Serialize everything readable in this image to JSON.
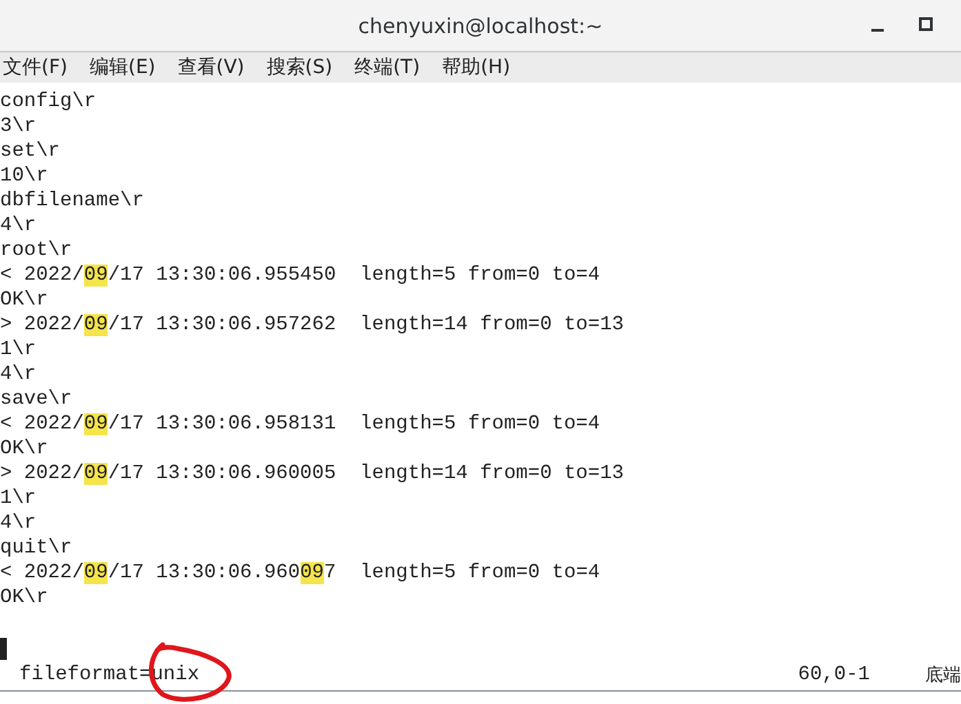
{
  "window": {
    "title": "chenyuxin@localhost:~"
  },
  "menu": [
    "文件(F)",
    "编辑(E)",
    "查看(V)",
    "搜索(S)",
    "终端(T)",
    "帮助(H)"
  ],
  "terminal": {
    "lines": [
      [
        {
          "text": "config\\r",
          "match": false
        }
      ],
      [
        {
          "text": "3\\r",
          "match": false
        }
      ],
      [
        {
          "text": "set\\r",
          "match": false
        }
      ],
      [
        {
          "text": "10\\r",
          "match": false
        }
      ],
      [
        {
          "text": "dbfilename\\r",
          "match": false
        }
      ],
      [
        {
          "text": "4\\r",
          "match": false
        }
      ],
      [
        {
          "text": "root\\r",
          "match": false
        }
      ],
      [
        {
          "text": "< 2022/",
          "match": false
        },
        {
          "text": "09",
          "match": true
        },
        {
          "text": "/17 13:30:06.955450  length=5 from=0 to=4",
          "match": false
        }
      ],
      [
        {
          "text": "OK\\r",
          "match": false
        }
      ],
      [
        {
          "text": "> 2022/",
          "match": false
        },
        {
          "text": "09",
          "match": true
        },
        {
          "text": "/17 13:30:06.957262  length=14 from=0 to=13",
          "match": false
        }
      ],
      [
        {
          "text": "1\\r",
          "match": false
        }
      ],
      [
        {
          "text": "4\\r",
          "match": false
        }
      ],
      [
        {
          "text": "save\\r",
          "match": false
        }
      ],
      [
        {
          "text": "< 2022/",
          "match": false
        },
        {
          "text": "09",
          "match": true
        },
        {
          "text": "/17 13:30:06.958131  length=5 from=0 to=4",
          "match": false
        }
      ],
      [
        {
          "text": "OK\\r",
          "match": false
        }
      ],
      [
        {
          "text": "> 2022/",
          "match": false
        },
        {
          "text": "09",
          "match": true
        },
        {
          "text": "/17 13:30:06.960005  length=14 from=0 to=13",
          "match": false
        }
      ],
      [
        {
          "text": "1\\r",
          "match": false
        }
      ],
      [
        {
          "text": "4\\r",
          "match": false
        }
      ],
      [
        {
          "text": "quit\\r",
          "match": false
        }
      ],
      [
        {
          "text": "< 2022/",
          "match": false
        },
        {
          "text": "09",
          "match": true
        },
        {
          "text": "/17 13:30:06.960",
          "match": false
        },
        {
          "text": "09",
          "match": true
        },
        {
          "text": "7  length=5 from=0 to=4",
          "match": false
        }
      ],
      [
        {
          "text": "OK\\r",
          "match": false
        }
      ]
    ],
    "status": {
      "message": "fileformat=unix",
      "position": "60,0-1",
      "scroll": "底端"
    }
  }
}
